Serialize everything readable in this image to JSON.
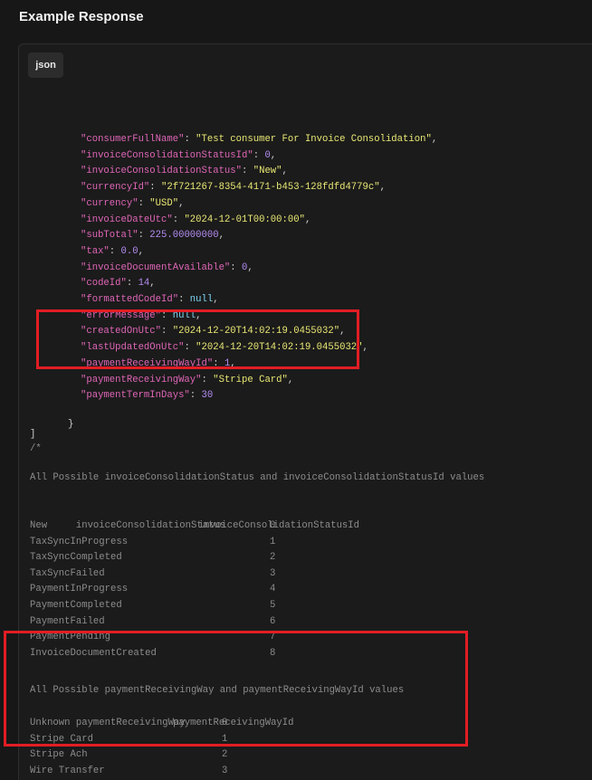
{
  "heading": "Example Response",
  "code_language": "json",
  "json_lines": [
    {
      "key": "consumerFullName",
      "value": "Test consumer For Invoice Consolidation",
      "type": "str"
    },
    {
      "key": "invoiceConsolidationStatusId",
      "value": "0",
      "type": "num"
    },
    {
      "key": "invoiceConsolidationStatus",
      "value": "New",
      "type": "str"
    },
    {
      "key": "currencyId",
      "value": "2f721267-8354-4171-b453-128fdfd4779c",
      "type": "str"
    },
    {
      "key": "currency",
      "value": "USD",
      "type": "str"
    },
    {
      "key": "invoiceDateUtc",
      "value": "2024-12-01T00:00:00",
      "type": "str"
    },
    {
      "key": "subTotal",
      "value": "225.00000000",
      "type": "num"
    },
    {
      "key": "tax",
      "value": "0.0",
      "type": "num"
    },
    {
      "key": "invoiceDocumentAvailable",
      "value": "0",
      "type": "num"
    },
    {
      "key": "codeId",
      "value": "14",
      "type": "num"
    },
    {
      "key": "formattedCodeId",
      "value": "null",
      "type": "kw"
    },
    {
      "key": "errorMessage",
      "value": "null",
      "type": "kw"
    },
    {
      "key": "createdOnUtc",
      "value": "2024-12-20T14:02:19.0455032",
      "type": "str"
    },
    {
      "key": "lastUpdatedOnUtc",
      "value": "2024-12-20T14:02:19.0455032",
      "type": "str"
    },
    {
      "key": "paymentReceivingWayId",
      "value": "1",
      "type": "num"
    },
    {
      "key": "paymentReceivingWay",
      "value": "Stripe Card",
      "type": "str"
    },
    {
      "key": "paymentTermInDays",
      "value": "30",
      "type": "num",
      "last": true
    }
  ],
  "close_object": "}",
  "close_array": "]",
  "comment_open": "/*",
  "status_table": {
    "title": "All Possible invoiceConsolidationStatus and invoiceConsolidationStatusId values",
    "headers": [
      "invoiceConsolidationStatus",
      "invoiceConsolidationStatusId"
    ],
    "rows": [
      [
        "New",
        "0"
      ],
      [
        "TaxSyncInProgress",
        "1"
      ],
      [
        "TaxSyncCompleted",
        "2"
      ],
      [
        "TaxSyncFailed",
        "3"
      ],
      [
        "PaymentInProgress",
        "4"
      ],
      [
        "PaymentCompleted",
        "5"
      ],
      [
        "PaymentFailed",
        "6"
      ],
      [
        "PaymentPending",
        "7"
      ],
      [
        "InvoiceDocumentCreated",
        "8"
      ]
    ]
  },
  "payment_table": {
    "title": "All Possible paymentReceivingWay and paymentReceivingWayId values",
    "headers": [
      "paymentReceivingWay",
      "paymentReceivingWayId"
    ],
    "rows": [
      [
        "Unknown",
        "0"
      ],
      [
        "Stripe Card",
        "1"
      ],
      [
        "Stripe Ach",
        "2"
      ],
      [
        "Wire Transfer",
        "3"
      ]
    ]
  },
  "comment_close": "*/",
  "colors": {
    "highlight": "#e21d24",
    "key": "#e066b8",
    "string": "#e9e874",
    "number": "#b48cf2",
    "keyword": "#7fd4f4"
  }
}
